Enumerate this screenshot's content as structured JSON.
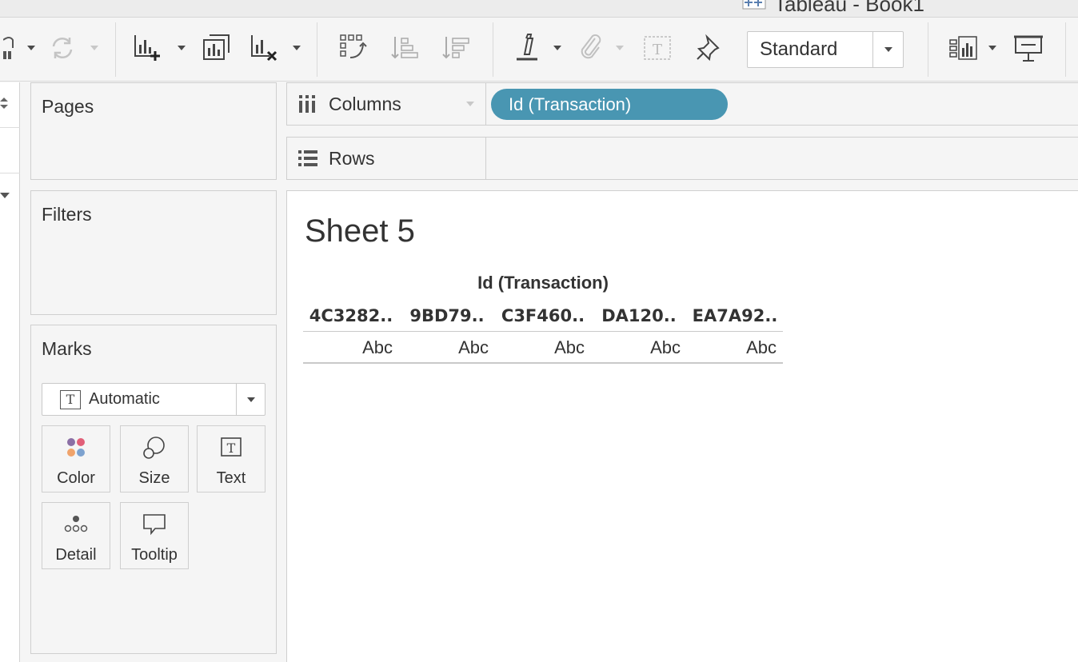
{
  "window": {
    "title": "Tableau - Book1"
  },
  "toolbar": {
    "fit_value": "Standard"
  },
  "cards": {
    "pages_title": "Pages",
    "filters_title": "Filters",
    "marks_title": "Marks",
    "mark_type": "Automatic",
    "buttons": [
      {
        "label": "Color"
      },
      {
        "label": "Size"
      },
      {
        "label": "Text"
      },
      {
        "label": "Detail"
      },
      {
        "label": "Tooltip"
      }
    ]
  },
  "shelves": {
    "columns_label": "Columns",
    "rows_label": "Rows",
    "columns_pill": "Id (Transaction)"
  },
  "view": {
    "sheet_title": "Sheet 5",
    "column_header": "Id (Transaction)",
    "headers": [
      "4C3282..",
      "9BD79..",
      "C3F460..",
      "DA120..",
      "EA7A92.."
    ],
    "values": [
      "Abc",
      "Abc",
      "Abc",
      "Abc",
      "Abc"
    ]
  },
  "colors": {
    "pill": "#4996b2",
    "color_dots": [
      "#8b6fa5",
      "#e15f78",
      "#f0a36b",
      "#7da2cf"
    ]
  }
}
